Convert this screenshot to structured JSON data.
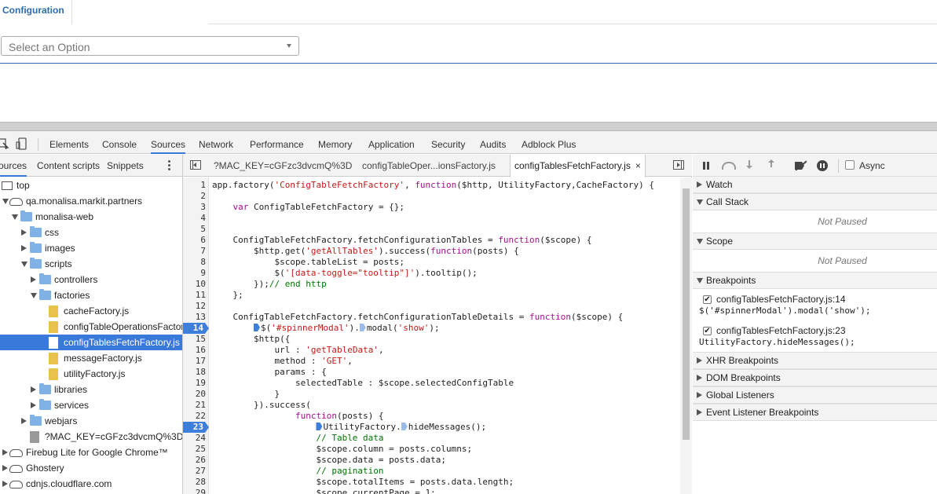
{
  "page": {
    "tab_label": "Configuration",
    "select_placeholder": "Select an Option"
  },
  "devtools": {
    "tabs": [
      {
        "label": "Elements"
      },
      {
        "label": "Console"
      },
      {
        "label": "Sources",
        "active": true
      },
      {
        "label": "Network"
      },
      {
        "label": "Performance"
      },
      {
        "label": "Memory"
      },
      {
        "label": "Application"
      },
      {
        "label": "Security"
      },
      {
        "label": "Audits"
      },
      {
        "label": "Adblock Plus"
      }
    ],
    "accent": "#3879d9"
  },
  "navigator": {
    "tabs": [
      "ources",
      "Content scripts",
      "Snippets"
    ],
    "tree": [
      {
        "label": "top",
        "icon": "frame-icon",
        "depth": 0,
        "toggle": "none"
      },
      {
        "label": "qa.monalisa.markit.partners",
        "icon": "cloud-icon",
        "depth": 0,
        "toggle": "open"
      },
      {
        "label": "monalisa-web",
        "icon": "folder-icon",
        "depth": 1,
        "toggle": "open"
      },
      {
        "label": "css",
        "icon": "folder-icon",
        "depth": 2,
        "toggle": "closed"
      },
      {
        "label": "images",
        "icon": "folder-icon",
        "depth": 2,
        "toggle": "closed"
      },
      {
        "label": "scripts",
        "icon": "folder-icon",
        "depth": 2,
        "toggle": "open"
      },
      {
        "label": "controllers",
        "icon": "folder-icon",
        "depth": 3,
        "toggle": "closed"
      },
      {
        "label": "factories",
        "icon": "folder-icon",
        "depth": 3,
        "toggle": "open"
      },
      {
        "label": "cacheFactory.js",
        "icon": "js-file-icon",
        "depth": 4,
        "toggle": "none"
      },
      {
        "label": "configTableOperationsFactor",
        "icon": "js-file-icon",
        "depth": 4,
        "toggle": "none"
      },
      {
        "label": "configTablesFetchFactory.js",
        "icon": "js-file-icon",
        "depth": 4,
        "toggle": "none",
        "selected": true
      },
      {
        "label": "messageFactory.js",
        "icon": "js-file-icon",
        "depth": 4,
        "toggle": "none"
      },
      {
        "label": "utilityFactory.js",
        "icon": "js-file-icon",
        "depth": 4,
        "toggle": "none"
      },
      {
        "label": "libraries",
        "icon": "folder-icon",
        "depth": 3,
        "toggle": "closed"
      },
      {
        "label": "services",
        "icon": "folder-icon",
        "depth": 3,
        "toggle": "closed"
      },
      {
        "label": "webjars",
        "icon": "folder-icon",
        "depth": 2,
        "toggle": "closed"
      },
      {
        "label": "?MAC_KEY=cGFzc3dvcmQ%3D",
        "icon": "document-icon",
        "depth": 2,
        "toggle": "none"
      },
      {
        "label": "Firebug Lite for Google Chrome™",
        "icon": "cloud-icon",
        "depth": 0,
        "toggle": "closed"
      },
      {
        "label": "Ghostery",
        "icon": "cloud-icon",
        "depth": 0,
        "toggle": "closed"
      },
      {
        "label": "cdnjs.cloudflare.com",
        "icon": "cloud-icon",
        "depth": 0,
        "toggle": "closed"
      }
    ]
  },
  "editor": {
    "tabs": [
      {
        "label": "?MAC_KEY=cGFzc3dvcmQ%3D"
      },
      {
        "label": "configTableOper...ionsFactory.js"
      },
      {
        "label": "configTablesFetchFactory.js",
        "active": true
      }
    ],
    "close_glyph": "×",
    "lines": [
      {
        "n": "1",
        "code": [
          [
            "p",
            "app.factory("
          ],
          [
            "s",
            "'ConfigTableFetchFactory'"
          ],
          [
            "p",
            ", "
          ],
          [
            "k",
            "function"
          ],
          [
            "p",
            "($http, UtilityFactory,CacheFactory) {"
          ]
        ]
      },
      {
        "n": "2",
        "code": []
      },
      {
        "n": "3",
        "code": [
          [
            "p",
            "    "
          ],
          [
            "k",
            "var"
          ],
          [
            "p",
            " ConfigTableFetchFactory = {};"
          ]
        ]
      },
      {
        "n": "4",
        "code": []
      },
      {
        "n": "5",
        "code": []
      },
      {
        "n": "6",
        "code": [
          [
            "p",
            "    ConfigTableFetchFactory.fetchConfigurationTables = "
          ],
          [
            "k",
            "function"
          ],
          [
            "p",
            "($scope) {"
          ]
        ]
      },
      {
        "n": "7",
        "code": [
          [
            "p",
            "        $http.get("
          ],
          [
            "s",
            "'getAllTables'"
          ],
          [
            "p",
            ").success("
          ],
          [
            "k",
            "function"
          ],
          [
            "p",
            "(posts) {"
          ]
        ]
      },
      {
        "n": "8",
        "code": [
          [
            "p",
            "            $scope.tableList = posts;"
          ]
        ]
      },
      {
        "n": "9",
        "code": [
          [
            "p",
            "            $("
          ],
          [
            "s",
            "'[data-toggle=\"tooltip\"]'"
          ],
          [
            "p",
            ").tooltip();"
          ]
        ]
      },
      {
        "n": "10",
        "code": [
          [
            "p",
            "        });"
          ],
          [
            "c",
            "// end http"
          ]
        ]
      },
      {
        "n": "11",
        "code": [
          [
            "p",
            "    };"
          ]
        ]
      },
      {
        "n": "12",
        "code": []
      },
      {
        "n": "13",
        "code": [
          [
            "p",
            "    ConfigTableFetchFactory.fetchConfigurationTableDetails = "
          ],
          [
            "k",
            "function"
          ],
          [
            "p",
            "($scope) {"
          ]
        ]
      },
      {
        "n": "14",
        "bp": true,
        "code": [
          [
            "p",
            "        "
          ],
          [
            "b",
            ""
          ],
          [
            "p",
            "$("
          ],
          [
            "s",
            "'#spinnerModal'"
          ],
          [
            "p",
            ")."
          ],
          [
            "l",
            ""
          ],
          [
            "p",
            "modal("
          ],
          [
            "s",
            "'show'"
          ],
          [
            "p",
            ");"
          ]
        ]
      },
      {
        "n": "15",
        "code": [
          [
            "p",
            "        $http({"
          ]
        ]
      },
      {
        "n": "16",
        "code": [
          [
            "p",
            "            url : "
          ],
          [
            "s",
            "'getTableData'"
          ],
          [
            "p",
            ","
          ]
        ]
      },
      {
        "n": "17",
        "code": [
          [
            "p",
            "            method : "
          ],
          [
            "s",
            "'GET'"
          ],
          [
            "p",
            ","
          ]
        ]
      },
      {
        "n": "18",
        "code": [
          [
            "p",
            "            params : {"
          ]
        ]
      },
      {
        "n": "19",
        "code": [
          [
            "p",
            "                selectedTable : $scope.selectedConfigTable"
          ]
        ]
      },
      {
        "n": "20",
        "code": [
          [
            "p",
            "            }"
          ]
        ]
      },
      {
        "n": "21",
        "code": [
          [
            "p",
            "        }).success("
          ]
        ]
      },
      {
        "n": "22",
        "code": [
          [
            "p",
            "                "
          ],
          [
            "k",
            "function"
          ],
          [
            "p",
            "(posts) {"
          ]
        ]
      },
      {
        "n": "23",
        "bp": true,
        "code": [
          [
            "p",
            "                    "
          ],
          [
            "b",
            ""
          ],
          [
            "p",
            "UtilityFactory."
          ],
          [
            "l",
            ""
          ],
          [
            "p",
            "hideMessages();"
          ]
        ]
      },
      {
        "n": "24",
        "code": [
          [
            "p",
            "                    "
          ],
          [
            "c",
            "// Table data"
          ]
        ]
      },
      {
        "n": "25",
        "code": [
          [
            "p",
            "                    $scope.column = posts.columns;"
          ]
        ]
      },
      {
        "n": "26",
        "code": [
          [
            "p",
            "                    $scope.data = posts.data;"
          ]
        ]
      },
      {
        "n": "27",
        "code": [
          [
            "p",
            "                    "
          ],
          [
            "c",
            "// pagination"
          ]
        ]
      },
      {
        "n": "28",
        "code": [
          [
            "p",
            "                    $scope.totalItems = posts.data.length;"
          ]
        ]
      },
      {
        "n": "29",
        "code": [
          [
            "p",
            "                    $scope.currentPage = 1;"
          ]
        ]
      }
    ]
  },
  "debugger": {
    "async_label": "Async",
    "sections": [
      {
        "label": "Watch",
        "open": false
      },
      {
        "label": "Call Stack",
        "open": true,
        "body": "Not Paused"
      },
      {
        "label": "Scope",
        "open": true,
        "body": "Not Paused"
      },
      {
        "label": "Breakpoints",
        "open": true
      }
    ],
    "breakpoints": [
      {
        "file": "configTablesFetchFactory.js:14",
        "code": "$('#spinnerModal').modal('show');",
        "checked": "✔"
      },
      {
        "file": "configTablesFetchFactory.js:23",
        "code": "UtilityFactory.hideMessages();",
        "checked": "✔"
      }
    ],
    "more_sections": [
      {
        "label": "XHR Breakpoints"
      },
      {
        "label": "DOM Breakpoints"
      },
      {
        "label": "Global Listeners"
      },
      {
        "label": "Event Listener Breakpoints"
      }
    ]
  }
}
